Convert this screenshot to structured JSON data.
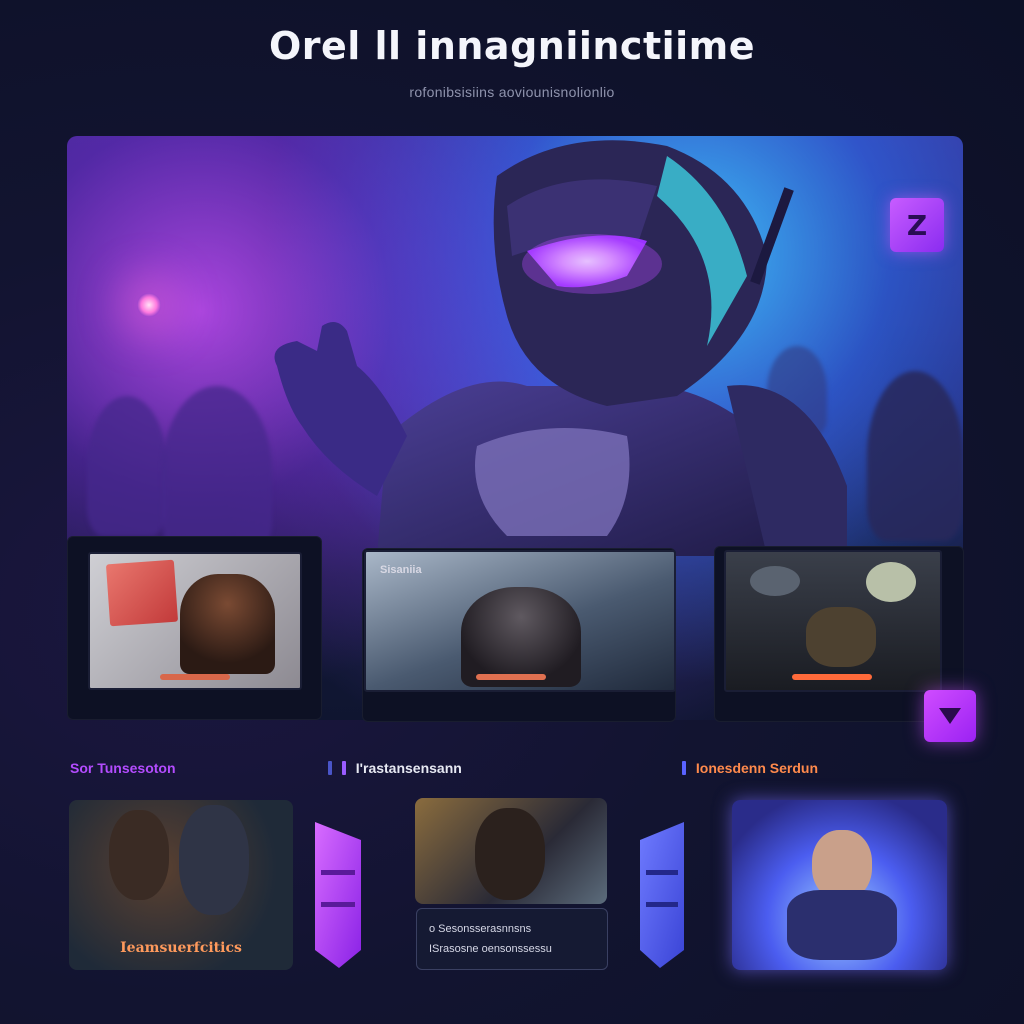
{
  "header": {
    "title": "Orel ll innagniinctiime",
    "subtitle": "rofonibsisiins aoviounisnolionlio"
  },
  "hero": {
    "badge_icon": "logo-badge-icon",
    "accent": "#b34cff"
  },
  "featured_thumbnails": [
    {
      "name": "thumbnail-1",
      "overlay_text": "",
      "bars": [
        "#d8674a"
      ]
    },
    {
      "name": "thumbnail-2",
      "overlay_text": "Sisaniia",
      "bars": [
        "#e07050"
      ]
    },
    {
      "name": "thumbnail-3",
      "overlay_text": "",
      "bars": [
        "#ff6a3a"
      ]
    }
  ],
  "play_button_icon": "play-triangle-icon",
  "sections": [
    {
      "label": "Sor Tunsesoton",
      "color": "#b44cff"
    },
    {
      "label": "I'rastansensann",
      "color": "#e7e9f3"
    },
    {
      "label": "Ionesdenn Serdun",
      "color": "#ff8a4c"
    }
  ],
  "cards": [
    {
      "caption": "Ieamsuerfcitics"
    },
    {
      "caption": ""
    },
    {
      "caption": ""
    }
  ],
  "info_box": {
    "line1": "o Sesonsserasnnsns",
    "line2": "ISrasosne oensonssessu"
  },
  "colors": {
    "background": "#121430",
    "accent_purple": "#b34cff",
    "accent_blue": "#5a63ff",
    "accent_orange": "#ff8a4c"
  }
}
